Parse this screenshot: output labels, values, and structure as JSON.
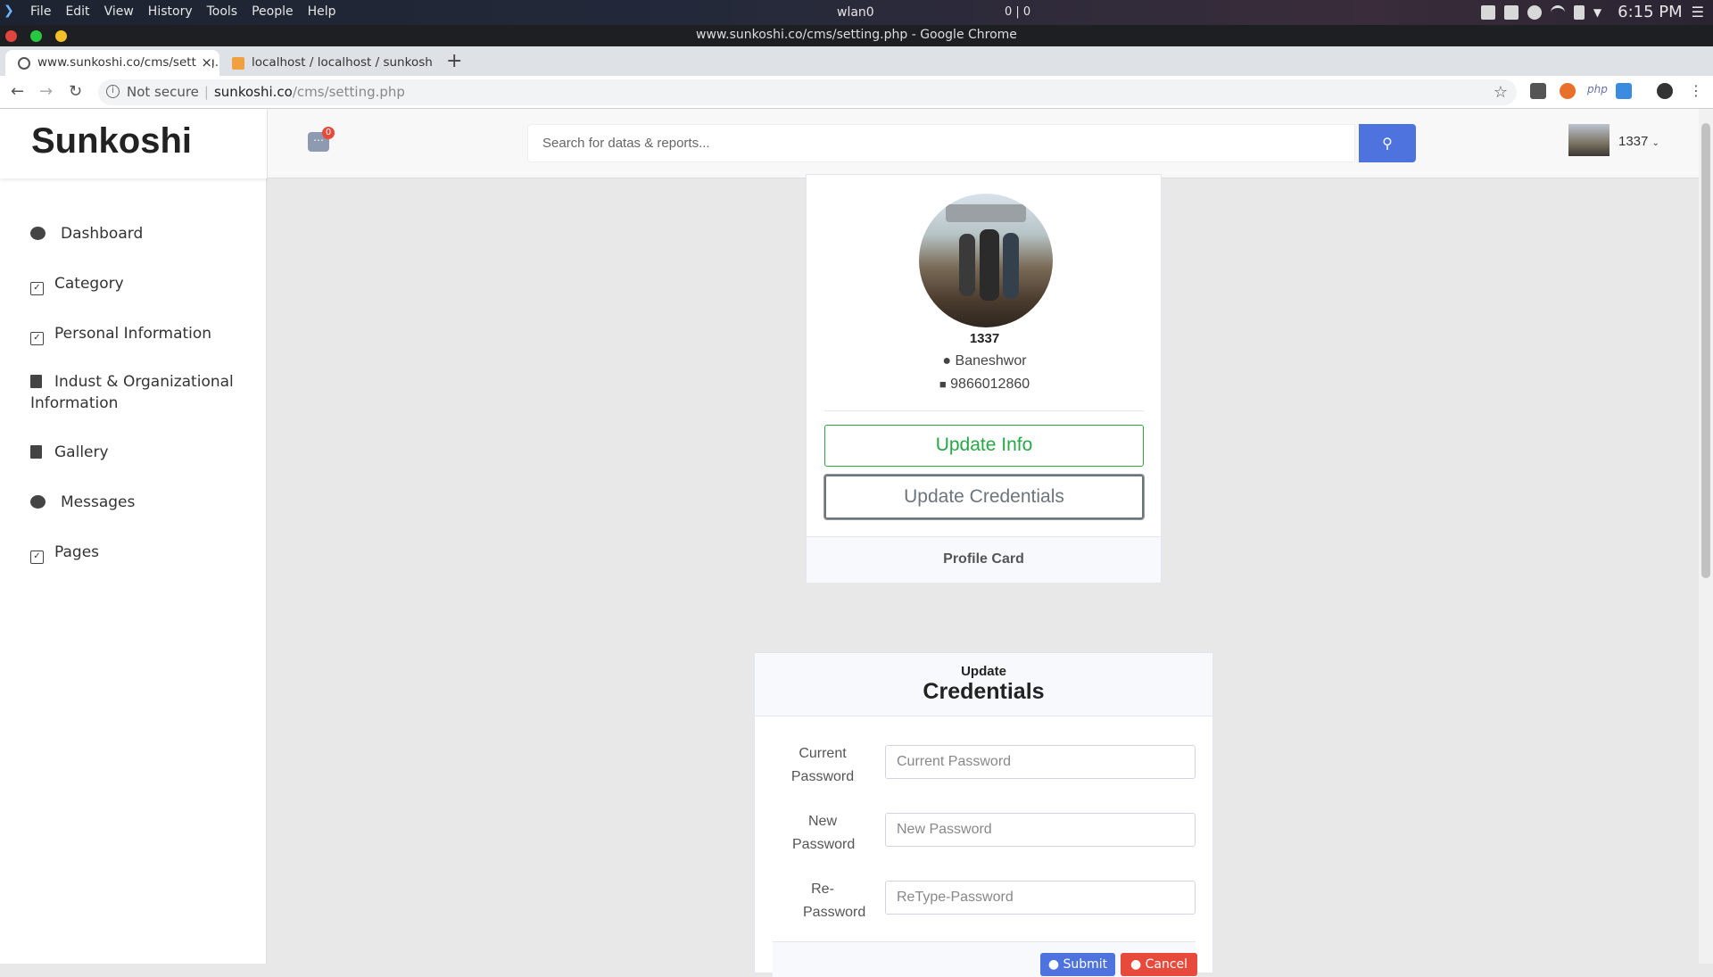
{
  "os": {
    "menu": [
      "File",
      "Edit",
      "View",
      "History",
      "Tools",
      "People",
      "Help"
    ],
    "network": "wlan0",
    "net_counter": "0 | 0",
    "clock": "6:15 PM"
  },
  "window": {
    "title": "www.sunkoshi.co/cms/setting.php - Google Chrome"
  },
  "tabs": [
    {
      "label": "www.sunkoshi.co/cms/setting.php",
      "close": "×"
    },
    {
      "label": "localhost / localhost / sunkoshi"
    }
  ],
  "new_tab": "+",
  "address": {
    "security": "Not secure",
    "host": "sunkoshi.co",
    "path": "/cms/setting.php"
  },
  "brand": "Sunkoshi",
  "sidebar": {
    "items": [
      {
        "label": "Dashboard",
        "icon": "gauge-icon"
      },
      {
        "label": "Category",
        "icon": "checkbox-icon"
      },
      {
        "label": "Personal Information",
        "icon": "checkbox-icon"
      },
      {
        "label": "Indust & Organizational Information",
        "icon": "copy-icon"
      },
      {
        "label": "Gallery",
        "icon": "copy-icon"
      },
      {
        "label": "Messages",
        "icon": "gauge-icon"
      },
      {
        "label": "Pages",
        "icon": "checkbox-icon"
      }
    ]
  },
  "topbar": {
    "message_count": "0",
    "search_placeholder": "Search for datas & reports...",
    "user": "1337"
  },
  "profile": {
    "name": "1337",
    "location": "Baneshwor",
    "phone": "9866012860",
    "update_info": "Update Info",
    "update_credentials": "Update Credentials",
    "footer": "Profile Card"
  },
  "credentials": {
    "heading_small": "Update",
    "heading_big": "Credentials",
    "fields": [
      {
        "label": "Current Password",
        "placeholder": "Current Password"
      },
      {
        "label": "New Password",
        "placeholder": "New Password"
      },
      {
        "label": "Re-Password",
        "placeholder": "ReType-Password"
      }
    ],
    "submit": "Submit",
    "cancel": "Cancel"
  },
  "colors": {
    "primary": "#4e73df",
    "success": "#28a745",
    "danger": "#e74a3b"
  }
}
